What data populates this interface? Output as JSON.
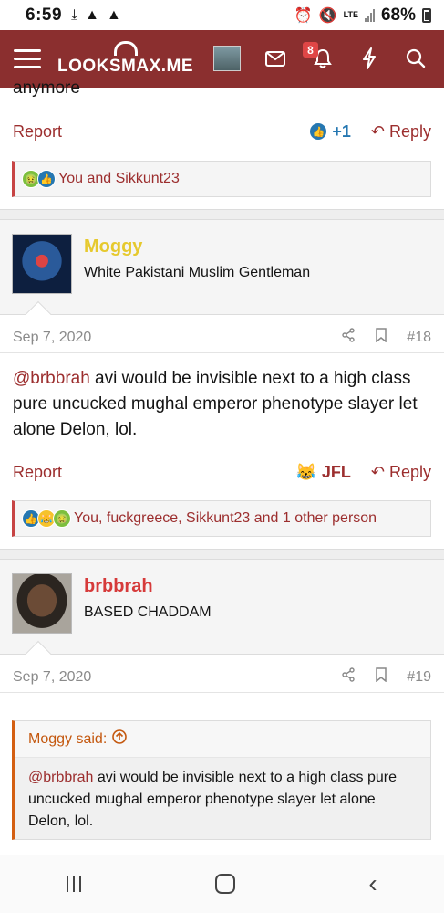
{
  "status": {
    "time": "6:59",
    "battery": "68%",
    "network": "LTE"
  },
  "header": {
    "logo": "LOOKSMAX.ME",
    "notification_count": "8"
  },
  "post17": {
    "cut_text": "anymore",
    "report": "Report",
    "like_count": "+1",
    "reply": "Reply",
    "reactions_text": "You and Sikkunt23"
  },
  "post18": {
    "username": "Moggy",
    "user_title": "White Pakistani Muslim Gentleman",
    "date": "Sep 7, 2020",
    "number": "#18",
    "mention": "@brbbrah",
    "body": " avi would be invisible next to a high class pure uncucked mughal emperor phenotype slayer let alone Delon, lol.",
    "report": "Report",
    "reaction_label": "JFL",
    "reply": "Reply",
    "reactions_text": "You, fuckgreece, Sikkunt23 and 1 other person"
  },
  "post19": {
    "username": "brbbrah",
    "user_title": "BASED CHADDAM",
    "date": "Sep 7, 2020",
    "number": "#19",
    "quote_author": "Moggy said:",
    "quote_mention": "@brbbrah",
    "quote_body": " avi would be invisible next to a high class pure uncucked mughal emperor phenotype slayer let alone Delon, lol."
  },
  "colors": {
    "brand": "#8b2f2f",
    "link": "#9c2e2e",
    "like": "#2577b1",
    "moggy": "#e6c92e",
    "brbbrah": "#d63a3a",
    "quote": "#d45f12"
  }
}
